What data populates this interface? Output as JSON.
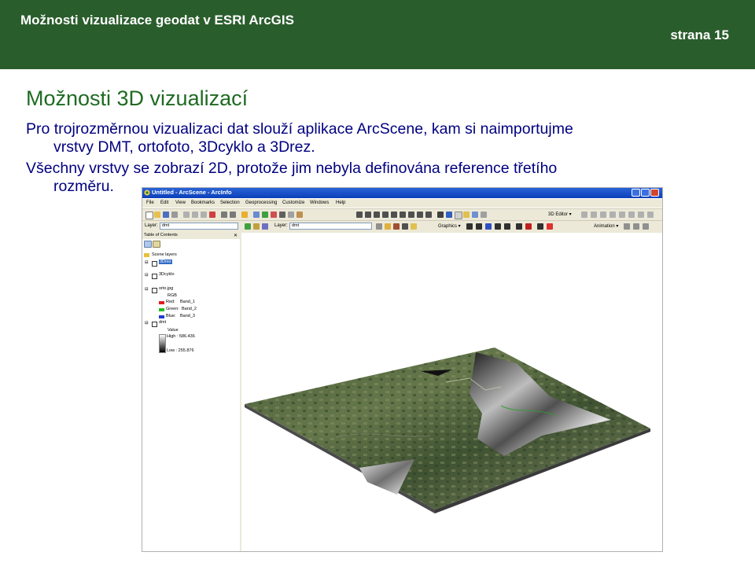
{
  "slide": {
    "header_title": "Možnosti vizualizace geodat v ESRI ArcGIS",
    "page_label": "strana 15",
    "title": "Možnosti 3D vizualizací",
    "para1_line1": "Pro trojrozměrnou vizualizaci dat slouží aplikace ArcScene, kam si naimportujme",
    "para1_line2": "vrstvy DMT, ortofoto, 3Dcyklo a 3Drez.",
    "para2_line1": "Všechny vrstvy se zobrazí 2D, protože jim nebyla definována reference třetího",
    "para2_line2": "rozměru.",
    "colors": {
      "header_bg": "#2a5d2c",
      "title": "#1e6b22",
      "text": "#000080"
    }
  },
  "app": {
    "window_title": "Untitled - ArcScene - ArcInfo",
    "menu": [
      "File",
      "Edit",
      "View",
      "Bookmarks",
      "Selection",
      "Geoprocessing",
      "Customize",
      "Windows",
      "Help"
    ],
    "toolbar": {
      "editor_label": "3D Editor ▾",
      "layer_label_left": "Layer:",
      "layer_value_left": "dmt",
      "layer_label_right": "Layer:",
      "layer_value_right": "dmt",
      "graphics_label": "Graphics ▾",
      "animation_label": "Animation ▾"
    },
    "toc": {
      "header": "Table of Contents",
      "scene_layers": "Scene layers",
      "layers": [
        {
          "name": "3Drez"
        },
        {
          "name": "3Dcyklo"
        },
        {
          "name": "orto.jpg",
          "sublabel": "RGB",
          "bands": [
            {
              "label": "Red:",
              "value": "Band_1",
              "color": "#e11f1f"
            },
            {
              "label": "Green:",
              "value": "Band_2",
              "color": "#20c020"
            },
            {
              "label": "Blue:",
              "value": "Band_3",
              "color": "#1f3bd6"
            }
          ]
        },
        {
          "name": "dmt",
          "sublabel": "Value",
          "high": "High : 586.436",
          "low": "Low : 255.876"
        }
      ]
    }
  }
}
